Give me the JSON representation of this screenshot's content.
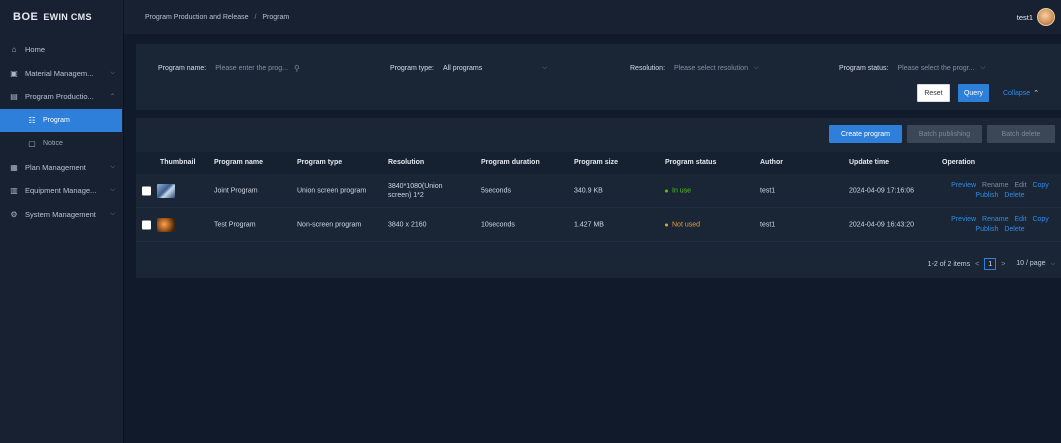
{
  "app": {
    "brand": "BOE",
    "name": "EWIN CMS"
  },
  "breadcrumb": {
    "parent": "Program Production and Release",
    "separator": "/",
    "current": "Program"
  },
  "user": {
    "name": "test1"
  },
  "sidebar": {
    "items": [
      {
        "label": "Home",
        "icon": "home-icon",
        "glyph": "⌂",
        "arrow": ""
      },
      {
        "label": "Material Managem...",
        "icon": "image-icon",
        "glyph": "▣",
        "arrow": "⌵"
      },
      {
        "label": "Program Productio...",
        "icon": "program-icon",
        "glyph": "▤",
        "arrow": "⌃"
      },
      {
        "label": "Program",
        "icon": "list-icon",
        "glyph": "☷",
        "arrow": ""
      },
      {
        "label": "Notice",
        "icon": "notice-icon",
        "glyph": "▢",
        "arrow": ""
      },
      {
        "label": "Plan Management",
        "icon": "calendar-icon",
        "glyph": "▦",
        "arrow": "⌵"
      },
      {
        "label": "Equipment Manage...",
        "icon": "device-icon",
        "glyph": "▥",
        "arrow": "⌵"
      },
      {
        "label": "System Management",
        "icon": "gear-icon",
        "glyph": "⚙",
        "arrow": "⌵"
      }
    ]
  },
  "filters": {
    "program_name": {
      "label": "Program name:",
      "placeholder": "Please enter the prog..."
    },
    "program_type": {
      "label": "Program type:",
      "value": "All programs"
    },
    "resolution": {
      "label": "Resolution:",
      "placeholder": "Please select resolution"
    },
    "program_status": {
      "label": "Program status:",
      "placeholder": "Please select the progr..."
    },
    "reset_label": "Reset",
    "query_label": "Query",
    "collapse_label": "Collapse"
  },
  "actions": {
    "create_label": "Create program",
    "batch_publish_label": "Batch publishing",
    "batch_delete_label": "Batch delete"
  },
  "table": {
    "columns": [
      "Thumbnail",
      "Program name",
      "Program type",
      "Resolution",
      "Program duration",
      "Program size",
      "Program status",
      "Author",
      "Update time",
      "Operation"
    ],
    "rows": [
      {
        "name": "Joint Program",
        "type": "Union screen program",
        "resolution": "3840*1080(Union screen) 1*2",
        "duration": "5seconds",
        "size": "340.9 KB",
        "status": "In use",
        "status_color": "#52c41a",
        "author": "test1",
        "updated": "2024-04-09 17:16:06",
        "ops": [
          "Preview",
          "Rename",
          "Edit",
          "Copy",
          "Publish",
          "Delete"
        ]
      },
      {
        "name": "Test Program",
        "type": "Non-screen program",
        "resolution": "3840 x 2160",
        "duration": "10seconds",
        "size": "1.427 MB",
        "status": "Not used",
        "status_color": "#e6a23c",
        "author": "test1",
        "updated": "2024-04-09 16:43:20",
        "ops": [
          "Preview",
          "Rename",
          "Edit",
          "Copy",
          "Publish",
          "Delete"
        ]
      }
    ]
  },
  "pagination": {
    "summary": "1-2 of 2 items",
    "current": "1",
    "page_size": "10 / page"
  }
}
